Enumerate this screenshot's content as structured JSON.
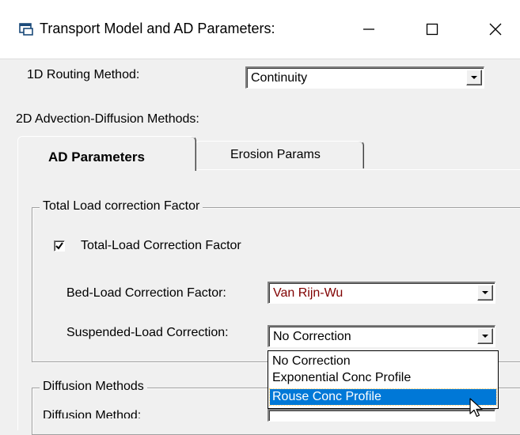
{
  "window": {
    "title": "Transport Model and AD Parameters:"
  },
  "routing": {
    "label": "1D Routing Method:",
    "value": "Continuity"
  },
  "ad_methods_label": "2D Advection-Diffusion Methods:",
  "tabs": [
    {
      "label": "AD Parameters",
      "active": true
    },
    {
      "label": "Erosion Params",
      "active": false
    }
  ],
  "total_load_group": {
    "title": "Total Load correction Factor",
    "checkbox": {
      "label": "Total-Load Correction Factor",
      "checked": true
    },
    "bedload": {
      "label": "Bed-Load Correction Factor:",
      "value": "Van Rijn-Wu",
      "value_color": "#800000"
    },
    "suspended": {
      "label": "Suspended-Load Correction:",
      "value": "No Correction",
      "options": [
        "No Correction",
        "Exponential Conc Profile",
        "Rouse Conc Profile"
      ],
      "highlighted": "Rouse Conc Profile"
    }
  },
  "diffusion_group": {
    "title": "Diffusion Methods",
    "method_label": "Diffusion Method:"
  },
  "colors": {
    "background": "#f0f0f0",
    "selection": "#0078d7",
    "bedload_text": "#800000"
  }
}
